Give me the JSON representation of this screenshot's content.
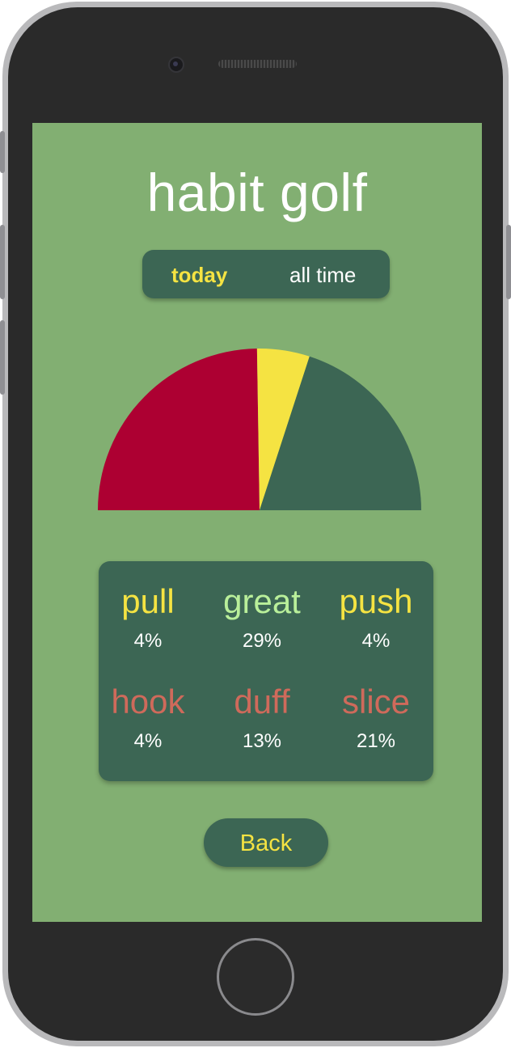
{
  "app": {
    "title": "habit golf"
  },
  "toggle": {
    "options": [
      "today",
      "all time"
    ],
    "selected": "today"
  },
  "colors": {
    "screen_background": "#82af72",
    "panel": "#3c6654",
    "accent_yellow": "#f5e342",
    "great_green": "#b9ef9a",
    "bad_red": "#cf6a5b",
    "chart_red": "#ad0032",
    "chart_yellow": "#f5e342",
    "chart_green": "#3c6654"
  },
  "chart_data": {
    "type": "pie",
    "shape": "semicircle",
    "slices": [
      {
        "value": 49.5,
        "color": "#ad0032"
      },
      {
        "value": 10.5,
        "color": "#f5e342"
      },
      {
        "value": 40.0,
        "color": "#3c6654"
      }
    ]
  },
  "stats": [
    {
      "label": "pull",
      "value": "4%",
      "color": "#f5e342"
    },
    {
      "label": "great",
      "value": "29%",
      "color": "#b9ef9a"
    },
    {
      "label": "push",
      "value": "4%",
      "color": "#f5e342"
    },
    {
      "label": "hook",
      "value": "4%",
      "color": "#cf6a5b"
    },
    {
      "label": "duff",
      "value": "13%",
      "color": "#cf6a5b"
    },
    {
      "label": "slice",
      "value": "21%",
      "color": "#cf6a5b"
    }
  ],
  "back_button": {
    "label": "Back"
  }
}
